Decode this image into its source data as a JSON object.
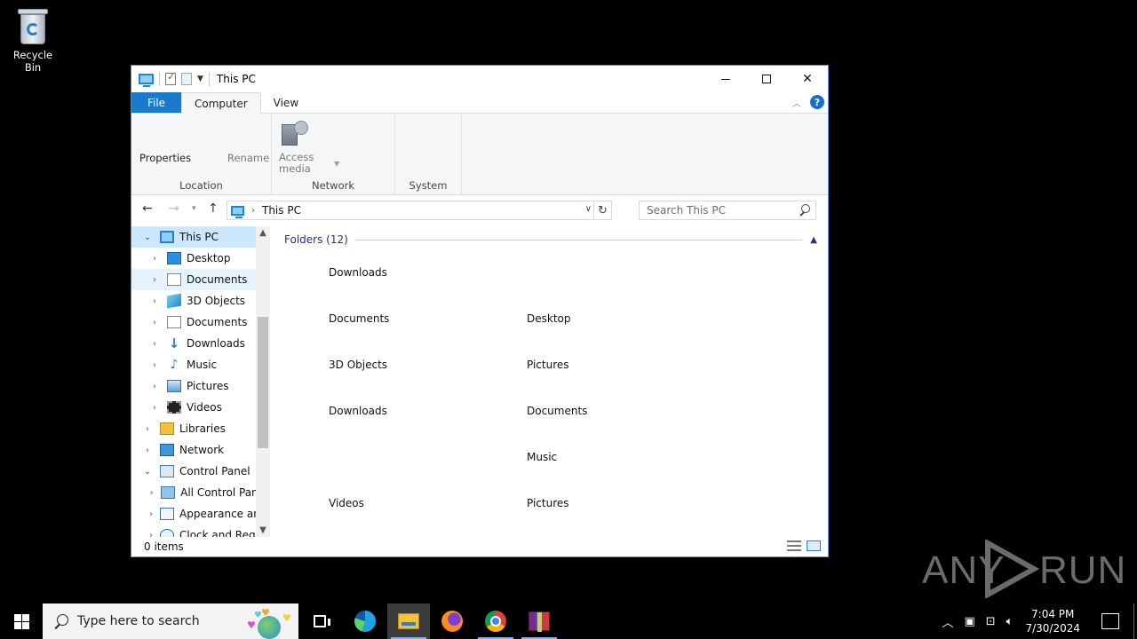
{
  "desktop": {
    "icons": [
      {
        "label": "Recycle Bin",
        "icon": "recycle-bin-icon"
      }
    ]
  },
  "window": {
    "title": "This PC",
    "controls": {
      "minimize": "minimize",
      "maximize": "maximize",
      "close": "✕"
    }
  },
  "ribbon": {
    "tabs": [
      {
        "label": "File",
        "selected": false
      },
      {
        "label": "Computer",
        "selected": true
      },
      {
        "label": "View",
        "selected": false
      }
    ],
    "help": "?",
    "groups": {
      "location": {
        "label": "Location",
        "properties": "Properties",
        "rename": "Rename"
      },
      "network": {
        "label": "Network",
        "access_media_line1": "Access",
        "access_media_line2": "media"
      },
      "system": {
        "label": "System"
      }
    }
  },
  "address": {
    "crumb": "This PC",
    "search_placeholder": "Search This PC"
  },
  "nav_pane": {
    "items": [
      {
        "label": "This PC",
        "icon": "this-pc-icon",
        "expanded": true,
        "selected": true
      },
      {
        "label": "Desktop",
        "icon": "desktop-folder-icon"
      },
      {
        "label": "Documents",
        "icon": "documents-folder-icon",
        "hovered": true
      },
      {
        "label": "3D Objects",
        "icon": "3d-objects-icon"
      },
      {
        "label": "Documents",
        "icon": "documents-folder-icon"
      },
      {
        "label": "Downloads",
        "icon": "downloads-icon"
      },
      {
        "label": "Music",
        "icon": "music-icon"
      },
      {
        "label": "Pictures",
        "icon": "pictures-icon"
      },
      {
        "label": "Videos",
        "icon": "videos-icon"
      },
      {
        "label": "Libraries",
        "icon": "libraries-icon"
      },
      {
        "label": "Network",
        "icon": "network-icon"
      },
      {
        "label": "Control Panel",
        "icon": "control-panel-icon",
        "expanded": true
      },
      {
        "label": "All Control Par",
        "icon": "all-control-panel-icon"
      },
      {
        "label": "Appearance an",
        "icon": "appearance-icon"
      },
      {
        "label": "Clock and Regi",
        "icon": "clock-region-icon"
      }
    ]
  },
  "content": {
    "group_header": "Folders (12)",
    "folders": [
      "Downloads",
      "Documents",
      "Desktop",
      "3D Objects",
      "Pictures",
      "Downloads",
      "Documents",
      "Music",
      "Videos",
      "Pictures"
    ]
  },
  "status": {
    "item_count": "0 items"
  },
  "taskbar": {
    "search_placeholder": "Type here to search",
    "apps": [
      "task-view-icon",
      "edge-icon",
      "file-explorer-icon",
      "firefox-icon",
      "chrome-icon",
      "winrar-icon"
    ],
    "time": "7:04 PM",
    "date": "7/30/2024"
  },
  "watermark": {
    "left": "ANY",
    "right": "RUN"
  }
}
